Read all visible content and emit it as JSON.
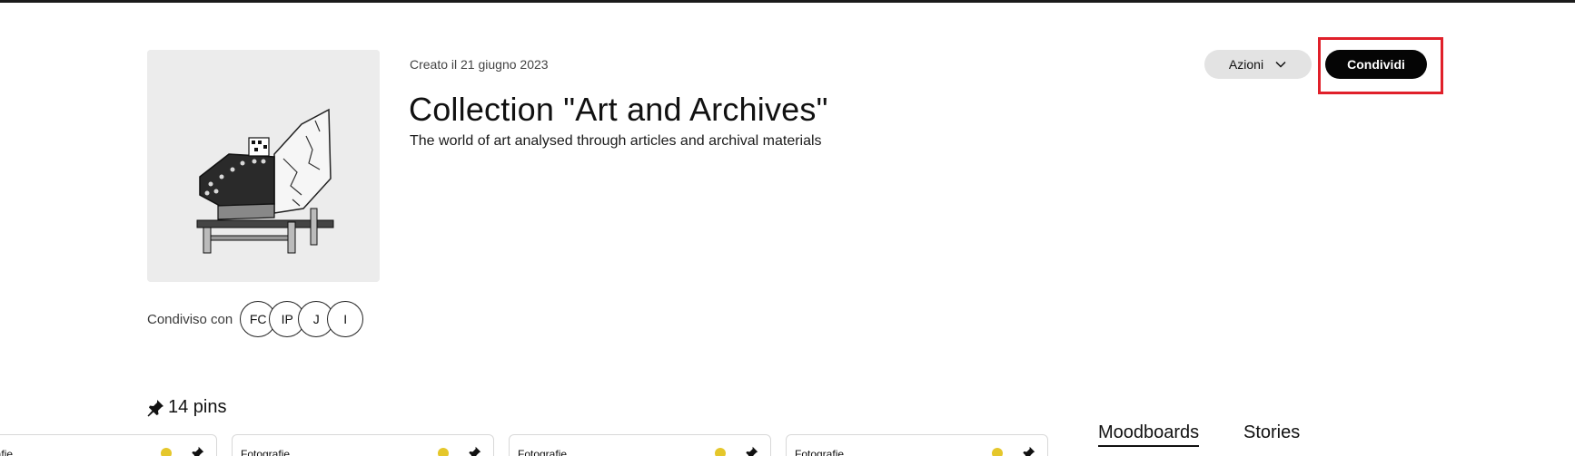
{
  "collection": {
    "created": "Creato il 21 giugno 2023",
    "title": "Collection \"Art and Archives\"",
    "description": "The world of art analysed through articles and archival materials",
    "shared_label": "Condiviso con",
    "shared_with": [
      "FC",
      "IP",
      "J",
      "I"
    ]
  },
  "actions": {
    "azioni_label": "Azioni",
    "condividi_label": "Condividi"
  },
  "pins": {
    "count_label": "14 pins",
    "cards": [
      {
        "label": "Fotografie",
        "dot_color": "#e5c72b"
      },
      {
        "label": "Fotografie",
        "dot_color": "#e5c72b"
      },
      {
        "label": "Fotografie",
        "dot_color": "#e5c72b"
      },
      {
        "label": "Fotografie",
        "dot_color": "#e5c72b"
      }
    ]
  },
  "tabs": {
    "moodboards": "Moodboards",
    "stories": "Stories",
    "active": "Moodboards"
  },
  "icons": {
    "pin": "pushpin-icon",
    "azioni_chevron": "chevron-down-icon"
  },
  "colors": {
    "highlight": "#e0202a",
    "primary_button": "#050505",
    "secondary_button": "#e3e3e3",
    "card_dot": "#e5c72b"
  }
}
